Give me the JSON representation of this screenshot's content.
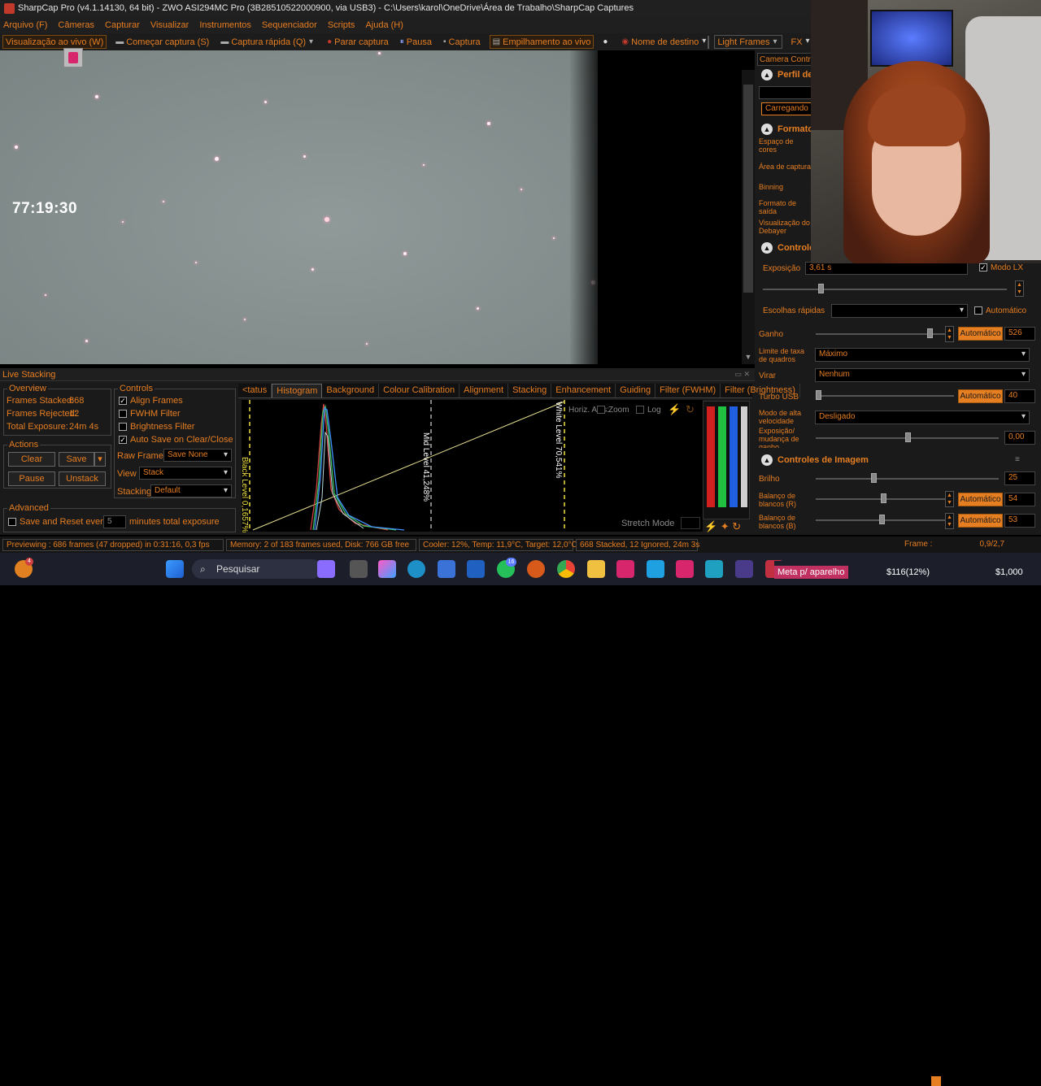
{
  "title": "SharpCap Pro (v4.1.14130, 64 bit) - ZWO ASI294MC Pro (3B28510522000900, via USB3) - C:\\Users\\karol\\OneDrive\\Área de Trabalho\\SharpCap Captures",
  "menu": [
    "Arquivo (F)",
    "Câmeras",
    "Capturar",
    "Visualizar",
    "Instrumentos",
    "Sequenciador",
    "Scripts",
    "Ajuda (H)"
  ],
  "toolbar": {
    "live_view": "Visualização ao vivo (W)",
    "start_capture": "Começar captura (S)",
    "quick_capture": "Captura rápida (Q)",
    "stop_capture": "Parar captura",
    "pause": "Pausa",
    "capture": "Captura",
    "live_stack": "Empilhamento ao vivo",
    "target_name": "Nome de destino",
    "frame_type": "Light Frames",
    "fx": "FX"
  },
  "preview": {
    "timer": "77:19:30"
  },
  "camera_panel": {
    "title": "Camera Control",
    "profile_section": "Perfil de C",
    "loading": "Carregando",
    "format_section": "Formato d",
    "colour_space": "Espaço de cores",
    "capture_area": "Área de captura",
    "binning": "Binning",
    "output_format": "Formato de saída",
    "debayer_preview": "Visualização do Debayer",
    "controls_section": "Controles",
    "exposure_label": "Exposição",
    "exposure_value": "3,61 s",
    "lx_mode": "Modo LX",
    "quick_picks": "Escolhas rápidas",
    "automatic": "Automático",
    "gain_label": "Ganho",
    "gain_auto": "Automático",
    "gain_value": "526",
    "frame_rate_label": "Limite de taxa de quadros",
    "frame_rate_value": "Máximo",
    "flip_label": "Virar",
    "flip_value": "Nenhum",
    "turbo_label": "Turbo USB",
    "turbo_auto": "Automático",
    "turbo_value": "40",
    "hispeed_label": "Modo de alta velocidade",
    "hispeed_value": "Desligado",
    "exp_change_label": "Exposição/ mudança de ganho",
    "exp_change_value": "0,00",
    "image_section": "Controles de Imagem",
    "brightness_label": "Brilho",
    "brightness_value": "25",
    "wb_r_label": "Balanço de blancos (R)",
    "wb_r_auto": "Automático",
    "wb_r_value": "54",
    "wb_b_label": "Balanço de blancos (B)",
    "wb_b_auto": "Automático",
    "wb_b_value": "53"
  },
  "live_stacking": {
    "title": "Live Stacking",
    "overview_title": "Overview",
    "frames_stacked": "Frames Stacked:",
    "frames_stacked_val": "668",
    "frames_rejected": "Frames Rejected:",
    "frames_rejected_val": "12",
    "total_exposure": "Total Exposure:",
    "total_exposure_val": "24m 4s",
    "actions_title": "Actions",
    "clear": "Clear",
    "save": "Save",
    "pause": "Pause",
    "unstack": "Unstack",
    "advanced_title": "Advanced",
    "save_reset": "Save and Reset every",
    "save_reset_val": "5",
    "minutes_total": "minutes total exposure",
    "controls_title": "Controls",
    "align": "Align Frames",
    "fwhm": "FWHM Filter",
    "brightness_filter": "Brightness Filter",
    "autosave": "Auto Save on Clear/Close",
    "raw_frames": "Raw Frames",
    "raw_frames_val": "Save None",
    "view": "View",
    "view_val": "Stack",
    "stacking": "Stacking",
    "stacking_val": "Default",
    "tabs": [
      "<tatus",
      "Histogram",
      "Background",
      "Colour Calibration",
      "Alignment",
      "Stacking",
      "Enhancement",
      "Guiding",
      "Filter (FWHM)",
      "Filter (Brightness)"
    ],
    "black_level": "Black Level 0,1657%",
    "mid_level": "Mid Level 41,248%",
    "white_level": "White Level 70,541%",
    "horiz_axis": "Horiz. Axis:",
    "zoom": "Zoom",
    "log": "Log",
    "stretch_mode": "Stretch Mode"
  },
  "status": {
    "previewing": "Previewing : 686 frames (47 dropped) in 0:31:16, 0,3 fps",
    "memory": "Memory: 2 of 183 frames used, Disk: 766 GB free",
    "cooler": "Cooler: 12%, Temp: 11,9°C, Target: 12,0°C",
    "stacked": "668 Stacked, 12 Ignored, 24m 3s",
    "frame": "Frame :",
    "frame_val": "0,9/2,7"
  },
  "taskbar": {
    "search": "Pesquisar",
    "notif": "16",
    "alert": "4",
    "ticker1": "Meta p/ aparelho",
    "ticker2": "$116(12%)",
    "ticker3": "$1,000"
  }
}
